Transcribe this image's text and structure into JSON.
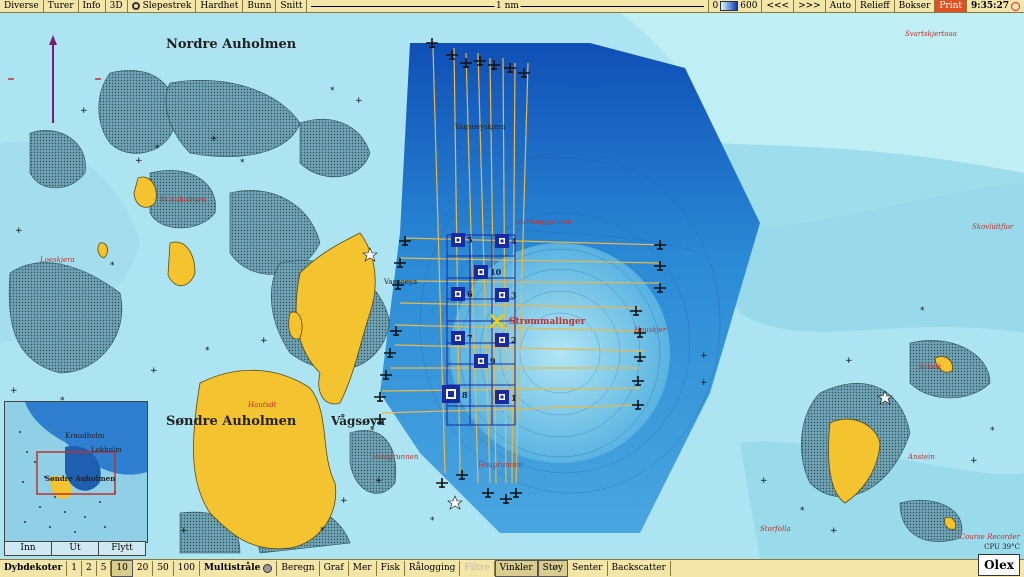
{
  "toolbar": {
    "menu": [
      "Diverse",
      "Turer",
      "Info",
      "3D",
      "Slepestrek",
      "Hardhet",
      "Bunn",
      "Snitt"
    ],
    "scale_label": "1 nm",
    "depth_min": "0",
    "depth_max": "600",
    "nav_back": "<<<",
    "nav_forward": ">>>",
    "right_buttons": [
      "Auto",
      "Relieff",
      "Bokser"
    ],
    "print_label": "Print",
    "clock": "9:35:27"
  },
  "map_labels": {
    "nordre": "Nordre Auholmen",
    "sondre": "Søndre Auholmen",
    "vagsoya": "Vågsøya",
    "vagsoya_small": "Vagsoeya",
    "strommalinger": "Strømmalinger",
    "vagsoeyskjera": "Vagsoeyskjera",
    "yt_auholmen": "Yt Auholmen",
    "loeskjera": "Loeskjera",
    "svartskjertoaa": "Svartskjertoaa",
    "skovliskjer": "Skovlidtflor",
    "auholmen_red": "Hautsdt",
    "anstein": "Anstein",
    "storfolla": "Storfolla",
    "asmoagrunnen": "Asmoagrunnen",
    "hauskjer": "Hauskjer",
    "haugr": "Haugrunnen",
    "sakvik": "Sakvik",
    "varsjona": "Vasagrunnen",
    "mini_lokholm": "Lokholm",
    "mini_sondre": "Søndre Auholmen",
    "mini_kratholm": "Kraudholm",
    "course_recorder": "Course Recorder",
    "cpu": "CPU 39°C"
  },
  "waypoints": [
    "5",
    "4",
    "10",
    "6",
    "3",
    "7",
    "2",
    "9",
    "8",
    "1"
  ],
  "minimap_buttons": [
    "Inn",
    "Ut",
    "Flytt"
  ],
  "bottombar": {
    "dybdekoter_label": "Dybdekoter",
    "depth_options": [
      "1",
      "2",
      "5",
      "10",
      "20",
      "50",
      "100"
    ],
    "selected_depth": "10",
    "multistraale": "Multistråle",
    "buttons": [
      "Beregn",
      "Graf",
      "Mer",
      "Fisk",
      "Rålogging"
    ],
    "filtre": "Filtre",
    "vinkler": "Vinkler",
    "stoy": "Støy",
    "senter": "Senter",
    "backscatter": "Backscatter"
  },
  "brand": "Olex",
  "colors": {
    "land": "#f4c430",
    "shallow": "#bfeef5",
    "mid": "#8ed6e8",
    "deep": "#1f6fc4",
    "track": "#e8b84a",
    "waypoint": "#1a2aa0"
  }
}
